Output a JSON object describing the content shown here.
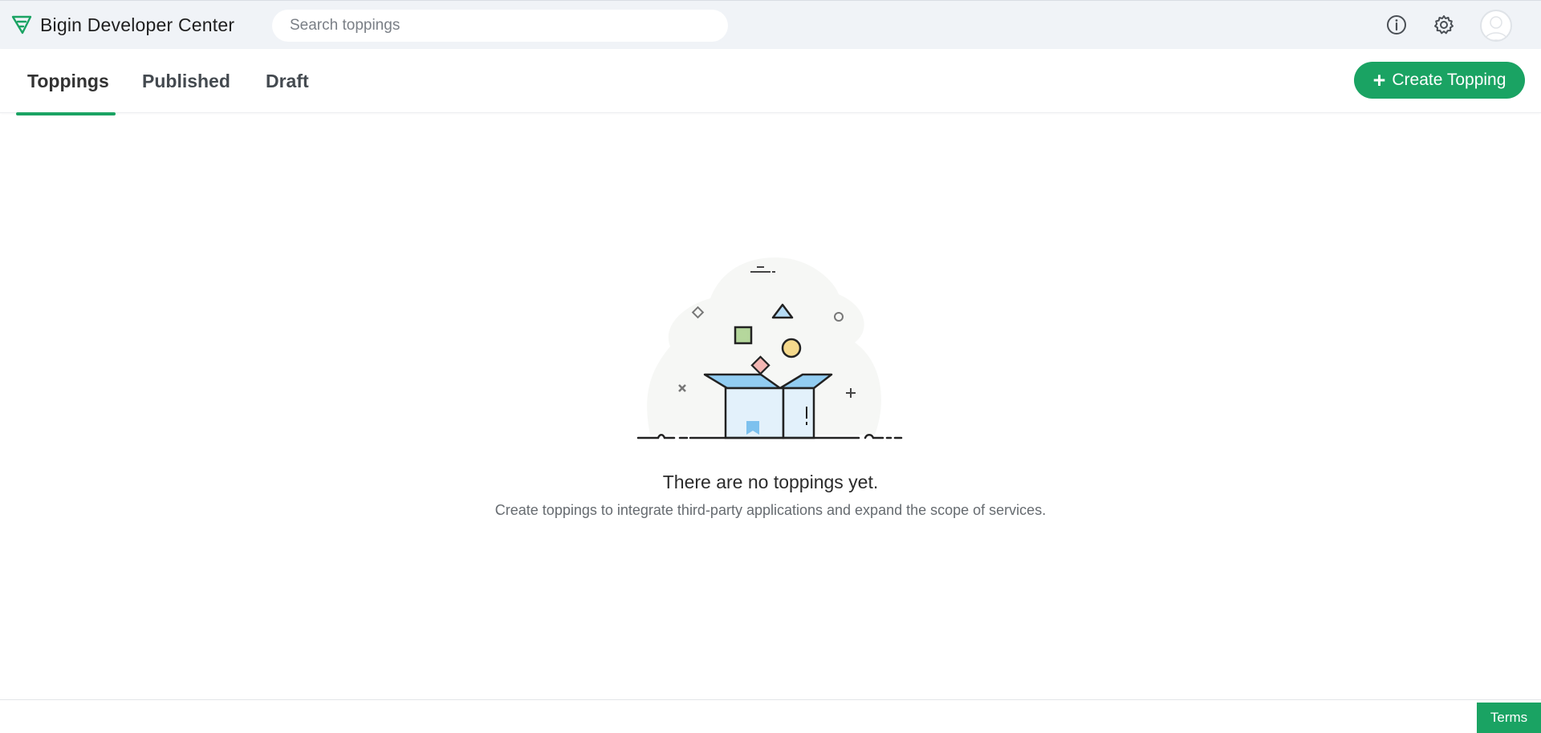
{
  "app": {
    "title": "Bigin Developer Center"
  },
  "search": {
    "placeholder": "Search toppings",
    "value": ""
  },
  "header_icons": [
    "info-icon",
    "gear-icon",
    "avatar"
  ],
  "tabs": [
    {
      "label": "Toppings",
      "active": true
    },
    {
      "label": "Published",
      "active": false
    },
    {
      "label": "Draft",
      "active": false
    }
  ],
  "create_button": {
    "icon": "plus-icon",
    "label": "Create Topping"
  },
  "empty_state": {
    "title": "There are no toppings yet.",
    "subtitle": "Create toppings to integrate third-party applications and expand the scope of services."
  },
  "footer": {
    "terms_label": "Terms"
  },
  "colors": {
    "accent": "#1aa363",
    "topbar_bg": "#f0f3f7"
  }
}
